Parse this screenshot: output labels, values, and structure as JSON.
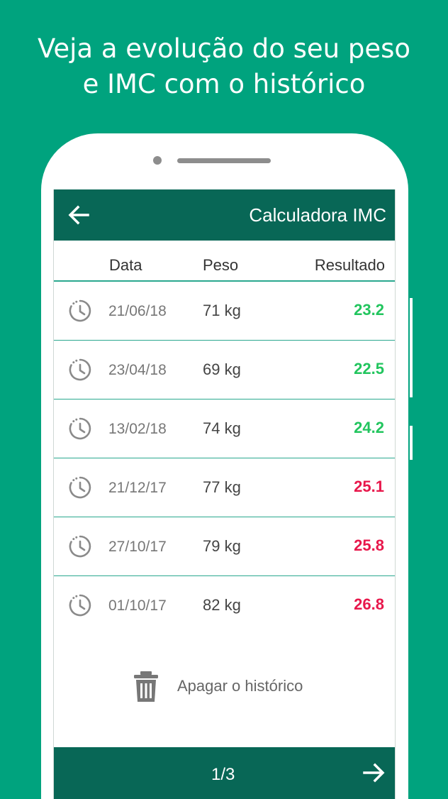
{
  "promo": {
    "line1": "Veja a evolução do seu peso",
    "line2": "e IMC com o histórico"
  },
  "appbar": {
    "back_icon": "arrow-left-icon",
    "title": "Calculadora IMC"
  },
  "table": {
    "headers": {
      "data": "Data",
      "peso": "Peso",
      "resultado": "Resultado"
    },
    "rows": [
      {
        "date": "21/06/18",
        "weight": "71 kg",
        "result": "23.2",
        "status": "normal"
      },
      {
        "date": "23/04/18",
        "weight": "69 kg",
        "result": "22.5",
        "status": "normal"
      },
      {
        "date": "13/02/18",
        "weight": "74 kg",
        "result": "24.2",
        "status": "normal"
      },
      {
        "date": "21/12/17",
        "weight": "77 kg",
        "result": "25.1",
        "status": "high"
      },
      {
        "date": "27/10/17",
        "weight": "79 kg",
        "result": "25.8",
        "status": "high"
      },
      {
        "date": "01/10/17",
        "weight": "82 kg",
        "result": "26.8",
        "status": "high"
      }
    ]
  },
  "clear_history": {
    "icon": "trash-icon",
    "label": "Apagar o histórico"
  },
  "footer": {
    "page": "1/3",
    "next_icon": "arrow-right-icon"
  },
  "colors": {
    "background": "#00a37e",
    "appbar": "#086756",
    "divider": "#2aa88f",
    "normal_result": "#22c55e",
    "high_result": "#e8174b"
  }
}
